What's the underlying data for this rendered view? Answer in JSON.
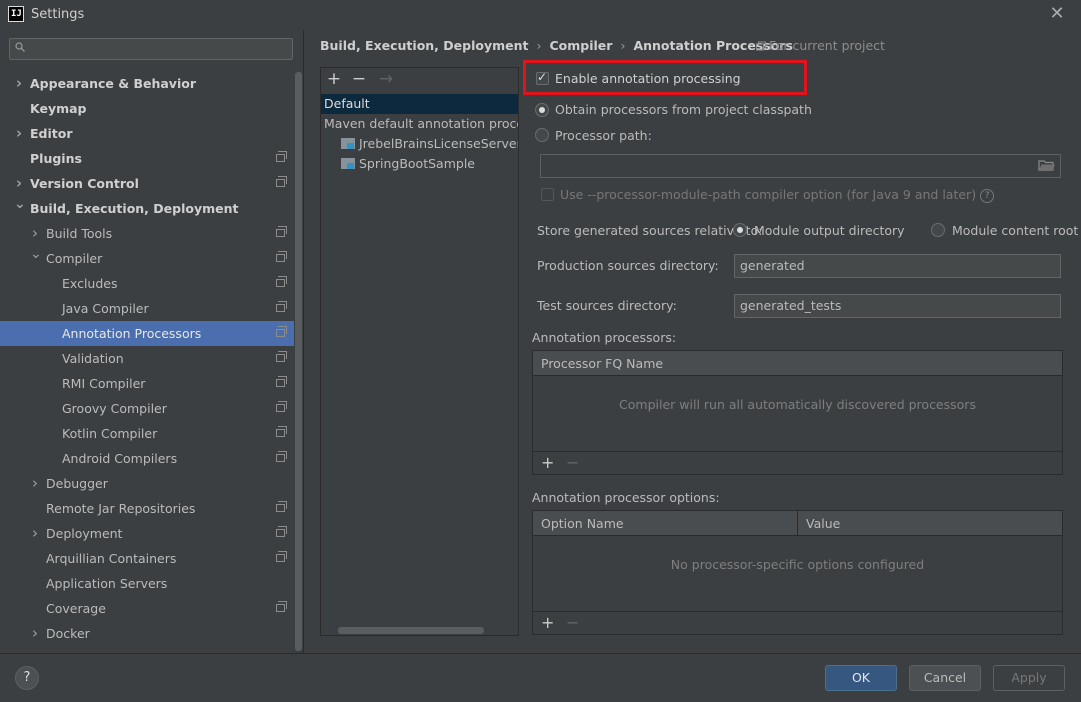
{
  "window": {
    "title": "Settings",
    "close_glyph": "✕"
  },
  "sidebar": {
    "search": {
      "value": "",
      "placeholder": ""
    },
    "items": [
      {
        "label": "Appearance & Behavior",
        "level": 0,
        "expandable": true,
        "expanded": false,
        "bold": true,
        "project": false
      },
      {
        "label": "Keymap",
        "level": 0,
        "expandable": false,
        "bold": true,
        "project": false
      },
      {
        "label": "Editor",
        "level": 0,
        "expandable": true,
        "expanded": false,
        "bold": true,
        "project": false
      },
      {
        "label": "Plugins",
        "level": 0,
        "expandable": false,
        "bold": true,
        "project": true
      },
      {
        "label": "Version Control",
        "level": 0,
        "expandable": true,
        "expanded": false,
        "bold": true,
        "project": true
      },
      {
        "label": "Build, Execution, Deployment",
        "level": 0,
        "expandable": true,
        "expanded": true,
        "bold": true,
        "project": false
      },
      {
        "label": "Build Tools",
        "level": 1,
        "expandable": true,
        "expanded": false,
        "project": true
      },
      {
        "label": "Compiler",
        "level": 1,
        "expandable": true,
        "expanded": true,
        "project": true
      },
      {
        "label": "Excludes",
        "level": 2,
        "project": true
      },
      {
        "label": "Java Compiler",
        "level": 2,
        "project": true
      },
      {
        "label": "Annotation Processors",
        "level": 2,
        "project": true,
        "selected": true
      },
      {
        "label": "Validation",
        "level": 2,
        "project": true
      },
      {
        "label": "RMI Compiler",
        "level": 2,
        "project": true
      },
      {
        "label": "Groovy Compiler",
        "level": 2,
        "project": true
      },
      {
        "label": "Kotlin Compiler",
        "level": 2,
        "project": true
      },
      {
        "label": "Android Compilers",
        "level": 2,
        "project": true
      },
      {
        "label": "Debugger",
        "level": 1,
        "expandable": true,
        "expanded": false,
        "project": false
      },
      {
        "label": "Remote Jar Repositories",
        "level": 1,
        "project": true
      },
      {
        "label": "Deployment",
        "level": 1,
        "expandable": true,
        "expanded": false,
        "project": true
      },
      {
        "label": "Arquillian Containers",
        "level": 1,
        "project": true
      },
      {
        "label": "Application Servers",
        "level": 1,
        "project": false
      },
      {
        "label": "Coverage",
        "level": 1,
        "project": true
      },
      {
        "label": "Docker",
        "level": 1,
        "expandable": true,
        "expanded": false,
        "project": false
      }
    ]
  },
  "breadcrumb": [
    "Build, Execution, Deployment",
    "Compiler",
    "Annotation Processors"
  ],
  "breadcrumb_separator": "›",
  "for_current_project": "For current project",
  "profiles": {
    "toolbar": {
      "add": "+",
      "remove": "−",
      "move": "→"
    },
    "items": [
      {
        "label": "Default",
        "selected": true,
        "folder": false,
        "indent": 0
      },
      {
        "label": "Maven default annotation processors profile",
        "folder": false,
        "indent": 0
      },
      {
        "label": "JrebelBrainsLicenseServerforJava",
        "folder": true,
        "indent": 1
      },
      {
        "label": "SpringBootSample",
        "folder": true,
        "indent": 1
      }
    ]
  },
  "options": {
    "enable_annotation_processing": {
      "label": "Enable annotation processing",
      "checked": true
    },
    "obtain_from_classpath": {
      "label": "Obtain processors from project classpath",
      "selected": true
    },
    "processor_path": {
      "label": "Processor path:",
      "selected": false,
      "value": ""
    },
    "module_path_option": {
      "label": "Use --processor-module-path compiler option (for Java 9 and later)",
      "checked": false,
      "help": "?"
    },
    "store_generated_label": "Store generated sources relative to:",
    "module_output_directory": {
      "label": "Module output directory",
      "selected": true
    },
    "module_content_root": {
      "label": "Module content root",
      "selected": false
    },
    "production_sources": {
      "label": "Production sources directory:",
      "value": "generated"
    },
    "test_sources": {
      "label": "Test sources directory:",
      "value": "generated_tests"
    }
  },
  "annotation_processors": {
    "title": "Annotation processors:",
    "column": "Processor FQ Name",
    "empty_text": "Compiler will run all automatically discovered processors",
    "add": "+",
    "remove": "−"
  },
  "processor_options": {
    "title": "Annotation processor options:",
    "columns": [
      "Option Name",
      "Value"
    ],
    "empty_text": "No processor-specific options configured",
    "add": "+",
    "remove": "−"
  },
  "footer": {
    "help": "?",
    "ok": "OK",
    "cancel": "Cancel",
    "apply": "Apply"
  },
  "colors": {
    "selection": "#4b6eaf",
    "highlight_box": "#e0141c",
    "ok_button": "#365880"
  }
}
